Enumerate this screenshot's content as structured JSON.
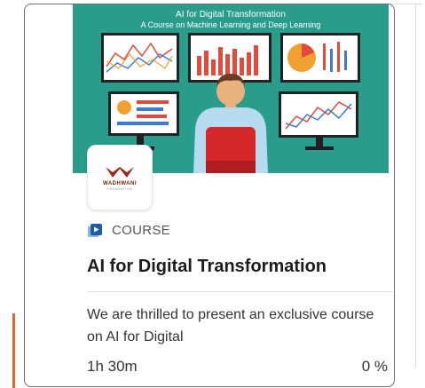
{
  "banner": {
    "title": "AI for Digital Transformation",
    "subtitle": "A Course on Machine Learning and Deep Learning"
  },
  "logo": {
    "brand": "WADHWANI",
    "sub": "FOUNDATION"
  },
  "card": {
    "type_label": "COURSE",
    "title": "AI for Digital Transformation",
    "description": "We are thrilled to present an exclusive course on AI for Digital",
    "duration": "1h 30m",
    "progress": "0 %"
  },
  "colors": {
    "banner_bg": "#2a9c8c",
    "accent": "#e8622c",
    "course_icon": "#1a5dab"
  }
}
